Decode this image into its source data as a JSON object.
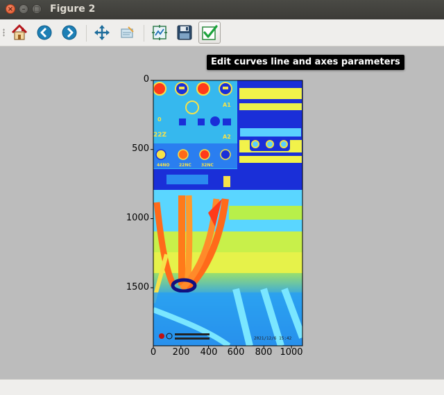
{
  "window": {
    "title": "Figure 2"
  },
  "titlebar_buttons": {
    "close": "×",
    "minimize": "–",
    "maximize": "□"
  },
  "toolbar": {
    "buttons": [
      {
        "icon": "home-icon"
      },
      {
        "icon": "back-arrow-icon"
      },
      {
        "icon": "forward-arrow-icon"
      },
      {
        "icon": "pan-arrows-icon"
      },
      {
        "icon": "zoom-rect-icon"
      },
      {
        "icon": "subplots-config-icon"
      },
      {
        "icon": "save-disk-icon"
      },
      {
        "icon": "checkmark-icon",
        "active": true
      }
    ]
  },
  "tooltip": {
    "text": "Edit curves line and axes parameters"
  },
  "plot": {
    "y_ticks": [
      "0",
      "500",
      "1000",
      "1500"
    ],
    "x_ticks": [
      "0",
      "200",
      "400",
      "600",
      "800",
      "1000"
    ],
    "image_labels": {
      "a1": "A1",
      "a2": "A2",
      "z22": "22Z",
      "no44": "44NO",
      "nc22": "22NC",
      "nc32": "32NC",
      "zero": "0",
      "timestamp": "2021/12/6 15:42"
    }
  },
  "chart_data": {
    "type": "heatmap",
    "xlim": [
      0,
      1080
    ],
    "ylim": [
      1920,
      0
    ],
    "x_ticks": [
      0,
      200,
      400,
      600,
      800,
      1000
    ],
    "y_ticks": [
      0,
      500,
      1000,
      1500
    ],
    "colormap": "jet"
  }
}
